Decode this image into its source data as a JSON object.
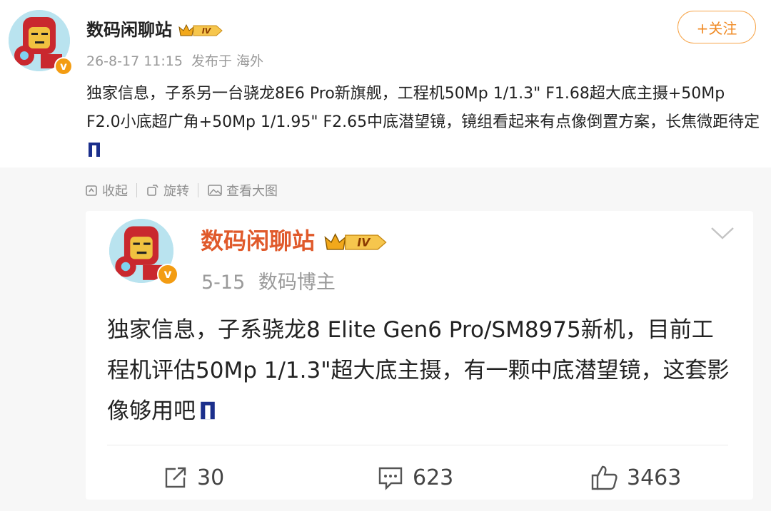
{
  "post": {
    "author": "数码闲聊站",
    "level_badge": "IV",
    "verified_mark": "v",
    "time": "26-8-17 11:15",
    "source": "发布于 海外",
    "follow_label": "+关注",
    "text": "独家信息，子系另一台骁龙8E6 Pro新旗舰，工程机50Mp 1/1.3\" F1.68超大底主摄+50Mp F2.0小底超广角+50Mp 1/1.95\" F2.65中底潜望镜，镜组看起来有点像倒置方案，长焦微距待定",
    "emoji_icon": "blue-bar-emoji"
  },
  "actions": {
    "collapse_label": "收起",
    "repost_label": "旋转",
    "view_image_label": "查看大图"
  },
  "repost": {
    "author": "数码闲聊站",
    "level_badge": "IV",
    "verified_mark": "v",
    "date": "5-15",
    "role": "数码博主",
    "text": "独家信息，子系骁龙8 Elite Gen6 Pro/SM8975新机，目前工程机评估50Mp 1/1.3\"超大底主摄，有一颗中底潜望镜，这套影像够用吧",
    "emoji_icon": "blue-bar-emoji",
    "reposts": "30",
    "comments": "623",
    "likes": "3463"
  },
  "colors": {
    "accent_orange": "#f08a24",
    "repost_name": "#e05a2b",
    "muted_text": "#9a9a9a",
    "grey_bg": "#f7f7f7"
  }
}
